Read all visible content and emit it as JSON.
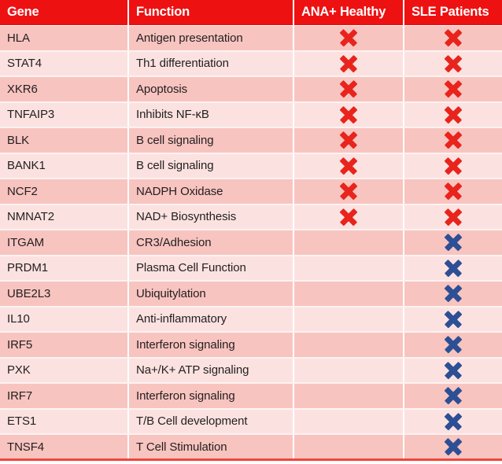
{
  "table": {
    "columns": [
      {
        "key": "gene",
        "label": "Gene"
      },
      {
        "key": "function",
        "label": "Function"
      },
      {
        "key": "ana",
        "label": "ANA+ Healthy"
      },
      {
        "key": "sle",
        "label": "SLE Patients"
      }
    ],
    "header_background": "#EE1111",
    "header_text_color": "#FFFFFF",
    "row_shade_dark": "#F8C4C0",
    "row_shade_light": "#FBE2E0",
    "mark_red_color": "#E8241C",
    "mark_blue_color": "#2C4F95",
    "mark_icon_name": "x-mark-icon",
    "rows": [
      {
        "gene": "HLA",
        "function": "Antigen presentation",
        "ana": "red",
        "sle": "red"
      },
      {
        "gene": "STAT4",
        "function": "Th1 differentiation",
        "ana": "red",
        "sle": "red"
      },
      {
        "gene": "XKR6",
        "function": "Apoptosis",
        "ana": "red",
        "sle": "red"
      },
      {
        "gene": "TNFAIP3",
        "function": "Inhibits NF-κB",
        "ana": "red",
        "sle": "red"
      },
      {
        "gene": "BLK",
        "function": "B cell signaling",
        "ana": "red",
        "sle": "red"
      },
      {
        "gene": "BANK1",
        "function": "B cell signaling",
        "ana": "red",
        "sle": "red"
      },
      {
        "gene": "NCF2",
        "function": "NADPH Oxidase",
        "ana": "red",
        "sle": "red"
      },
      {
        "gene": "NMNAT2",
        "function": "NAD+ Biosynthesis",
        "ana": "red",
        "sle": "red"
      },
      {
        "gene": "ITGAM",
        "function": "CR3/Adhesion",
        "ana": "none",
        "sle": "blue"
      },
      {
        "gene": "PRDM1",
        "function": "Plasma Cell Function",
        "ana": "none",
        "sle": "blue"
      },
      {
        "gene": "UBE2L3",
        "function": "Ubiquitylation",
        "ana": "none",
        "sle": "blue"
      },
      {
        "gene": "IL10",
        "function": "Anti-inflammatory",
        "ana": "none",
        "sle": "blue"
      },
      {
        "gene": "IRF5",
        "function": "Interferon signaling",
        "ana": "none",
        "sle": "blue"
      },
      {
        "gene": "PXK",
        "function": "Na+/K+ ATP signaling",
        "ana": "none",
        "sle": "blue"
      },
      {
        "gene": "IRF7",
        "function": "Interferon signaling",
        "ana": "none",
        "sle": "blue"
      },
      {
        "gene": "ETS1",
        "function": "T/B Cell development",
        "ana": "none",
        "sle": "blue"
      },
      {
        "gene": "TNSF4",
        "function": "T Cell Stimulation",
        "ana": "none",
        "sle": "blue"
      }
    ]
  }
}
